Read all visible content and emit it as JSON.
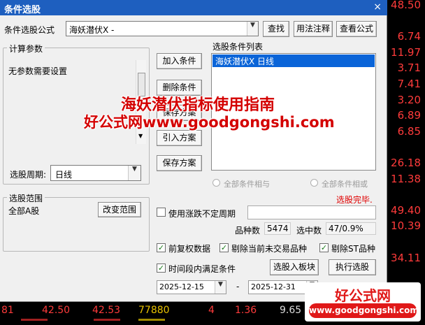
{
  "window": {
    "title": "条件选股",
    "close": "×"
  },
  "background": {
    "right_values": [
      "48.50",
      "",
      "6.74",
      "11.97",
      "3.71",
      "7.41",
      "3.20",
      "6.89",
      "6.85",
      "",
      "26.18",
      "11.38",
      "",
      "49.40",
      "10.39",
      "",
      "34.11",
      "",
      "15.70",
      "11.74"
    ],
    "bottom_row": [
      "81",
      "42.50",
      "42.53",
      "77880",
      "4",
      "1.36",
      "9.65"
    ]
  },
  "formula": {
    "label": "条件选股公式",
    "value": "海妖潜伏X  -",
    "find": "查找",
    "usage": "用法注释",
    "view": "查看公式"
  },
  "params": {
    "group_label": "计算参数",
    "text": "无参数需要设置"
  },
  "middle_buttons": {
    "add": "加入条件",
    "delete": "删除条件",
    "save_as": "保存方案",
    "import": "引入方案",
    "save": "保存方案"
  },
  "condition_list": {
    "label": "选股条件列表",
    "items": [
      "海妖潜伏X  日线"
    ]
  },
  "period": {
    "label": "选股周期:",
    "value": "日线"
  },
  "logic": {
    "and_label": "全部条件相与",
    "or_label": "全部条件相或"
  },
  "status": {
    "text": "选股完毕.",
    "color": "#e00000"
  },
  "range": {
    "group_label": "选股范围",
    "value": "全部A股",
    "change": "改变范围"
  },
  "variable_period": {
    "label": "使用涨跌不定周期",
    "value": ""
  },
  "counts": {
    "total_label": "品种数",
    "total": "5474",
    "selected_label": "选中数",
    "selected": "47/0.9%"
  },
  "options": {
    "adjust": "前复权数据",
    "exclude_no_trade": "剔除当前未交易品种",
    "exclude_st": "剔除ST品种",
    "time_range": "时间段内满足条件"
  },
  "actions": {
    "to_board": "选股入板块",
    "execute": "执行选股"
  },
  "dates": {
    "start": "2025-12-15",
    "dash": "-",
    "end": "2025-12-31"
  },
  "watermark": {
    "line1": "海妖潜伏指标使用指南",
    "line2": "好公式网www.goodgongshi.com",
    "logo_title": "好公式网",
    "logo_url": "www.goodgongshi.com"
  }
}
